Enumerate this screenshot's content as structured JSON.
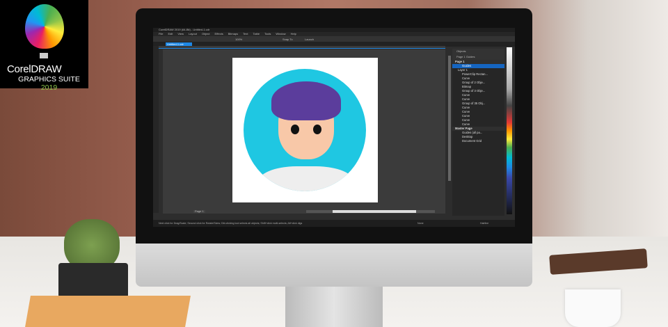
{
  "logo": {
    "name": "CorelDRAW",
    "suite": "GRAPHICS SUITE",
    "year": "2019"
  },
  "app": {
    "title": "CorelDRAW 2019 (64-Bit) - Untitled-1.cdr",
    "menu": [
      "File",
      "Edit",
      "View",
      "Layout",
      "Object",
      "Effects",
      "Bitmaps",
      "Text",
      "Table",
      "Tools",
      "Window",
      "Help"
    ],
    "zoom": "100%",
    "snap": "Snap To",
    "launch": "Launch",
    "doc_tab": "Untitled-1.cdr",
    "page_tab": "Page 1",
    "status_hint": "Next click for Drag/Scale; Second click for Rotate/Skew; Dbl-clicking tool selects all objects; Shift+click multi-selects; Alt+click digs",
    "fill_label": "None",
    "outline_label": "Hairline"
  },
  "objects_panel": {
    "title": "Objects",
    "page_selector": "Page 1",
    "guides_label": "Guides",
    "rows": [
      {
        "label": "Page 1",
        "type": "header"
      },
      {
        "label": "Guides",
        "type": "selected"
      },
      {
        "label": "Layer 1",
        "type": "layer"
      },
      {
        "label": "PowerClip Rectan..."
      },
      {
        "label": "Curve"
      },
      {
        "label": "Group of 2 Obje..."
      },
      {
        "label": "Bitmap"
      },
      {
        "label": "Group of 3 Obje..."
      },
      {
        "label": "Curve"
      },
      {
        "label": "Curve"
      },
      {
        "label": "Group of 35 Obj..."
      },
      {
        "label": "Curve"
      },
      {
        "label": "Curve"
      },
      {
        "label": "Curve"
      },
      {
        "label": "Curve"
      },
      {
        "label": "Curve"
      },
      {
        "label": "Master Page",
        "type": "header"
      },
      {
        "label": "Guides (all pa..."
      },
      {
        "label": "Desktop"
      },
      {
        "label": "Document Grid"
      }
    ]
  },
  "colors": {
    "accent": "#1e88e5",
    "avatar_bg": "#1fc7e2",
    "hair": "#5b3d9c"
  }
}
